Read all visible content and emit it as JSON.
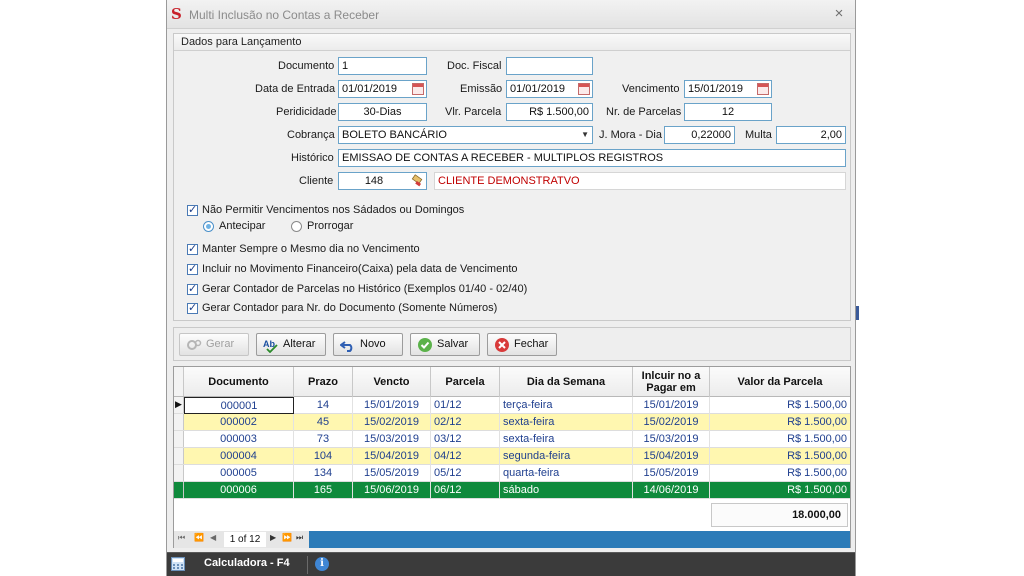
{
  "window": {
    "title": "Multi Inclusão no Contas a Receber",
    "close": "×"
  },
  "form": {
    "section_title": "Dados para Lançamento",
    "documento": {
      "label": "Documento",
      "value": "1"
    },
    "doc_fiscal": {
      "label": "Doc. Fiscal",
      "value": ""
    },
    "data_entrada": {
      "label": "Data de Entrada",
      "value": "01/01/2019"
    },
    "emissao": {
      "label": "Emissão",
      "value": "01/01/2019"
    },
    "vencimento": {
      "label": "Vencimento",
      "value": "15/01/2019"
    },
    "periodicidade": {
      "label": "Peridicidade",
      "value": "30-Dias"
    },
    "vlr_parcela": {
      "label": "Vlr. Parcela",
      "value": "R$ 1.500,00"
    },
    "nr_parcelas": {
      "label": "Nr. de Parcelas",
      "value": "12"
    },
    "cobranca": {
      "label": "Cobrança",
      "value": "BOLETO BANCÁRIO"
    },
    "j_mora": {
      "label": "J. Mora - Dia",
      "value": "0,22000"
    },
    "multa": {
      "label": "Multa",
      "value": "2,00"
    },
    "historico": {
      "label": "Histórico",
      "value": "EMISSAO DE CONTAS A RECEBER - MULTIPLOS REGISTROS"
    },
    "cliente": {
      "label": "Cliente",
      "code": "148",
      "name": "CLIENTE DEMONSTRATVO"
    }
  },
  "options": {
    "nao_permitir": "Não Permitir Vencimentos nos Sádados ou Domingos",
    "antecipar": "Antecipar",
    "prorrogar": "Prorrogar",
    "manter_dia": "Manter Sempre o Mesmo dia no Vencimento",
    "incluir_mov": "Incluir  no Movimento Financeiro(Caixa) pela data de Vencimento",
    "gerar_hist": "Gerar Contador de Parcelas no Histórico (Exemplos 01/40 - 02/40)",
    "gerar_doc": "Gerar Contador para Nr. do Documento (Somente Números)"
  },
  "toolbar": {
    "gerar": "Gerar",
    "alterar": "Alterar",
    "novo": "Novo",
    "salvar": "Salvar",
    "fechar": "Fechar"
  },
  "grid": {
    "columns": [
      "Documento",
      "Prazo",
      "Vencto",
      "Parcela",
      "Dia da Semana",
      "Inlcuir no a Pagar em",
      "Valor da Parcela"
    ],
    "rows": [
      [
        "000001",
        "14",
        "15/01/2019",
        "01/12",
        "terça-feira",
        "15/01/2019",
        "R$ 1.500,00"
      ],
      [
        "000002",
        "45",
        "15/02/2019",
        "02/12",
        "sexta-feira",
        "15/02/2019",
        "R$ 1.500,00"
      ],
      [
        "000003",
        "73",
        "15/03/2019",
        "03/12",
        "sexta-feira",
        "15/03/2019",
        "R$ 1.500,00"
      ],
      [
        "000004",
        "104",
        "15/04/2019",
        "04/12",
        "segunda-feira",
        "15/04/2019",
        "R$ 1.500,00"
      ],
      [
        "000005",
        "134",
        "15/05/2019",
        "05/12",
        "quarta-feira",
        "15/05/2019",
        "R$ 1.500,00"
      ],
      [
        "000006",
        "165",
        "15/06/2019",
        "06/12",
        "sábado",
        "14/06/2019",
        "R$ 1.500,00"
      ]
    ],
    "total": "18.000,00",
    "pager": "1 of 12"
  },
  "statusbar": {
    "calc_label": "Calculadora - F4"
  },
  "colors": {
    "selected_row": "#0f8a3c",
    "alt_row": "#fff7b0",
    "nav_bar": "#2c7bb8",
    "accent_border": "#6aa3c9"
  }
}
